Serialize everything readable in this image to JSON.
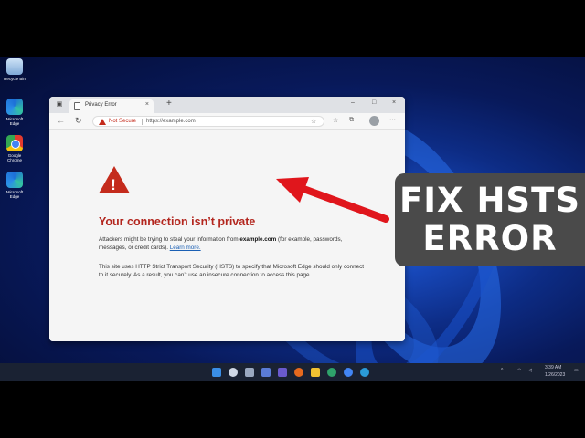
{
  "desktop": {
    "icons": [
      {
        "label": "Recycle Bin",
        "type": "recycle"
      },
      {
        "label": "Microsoft Edge",
        "type": "edge"
      },
      {
        "label": "Google Chrome",
        "type": "chrome"
      },
      {
        "label": "Microsoft Edge",
        "type": "edge"
      }
    ]
  },
  "browser": {
    "tab_title": "Privacy Error",
    "tab_close": "×",
    "new_tab": "+",
    "window_controls": {
      "minimize": "–",
      "maximize": "□",
      "close": "×"
    },
    "nav": {
      "back": "←",
      "refresh": "↻"
    },
    "address": {
      "security": "Not Secure",
      "url": "https://example.com"
    },
    "toolbar_icons": [
      "favorites-icon",
      "collections-icon",
      "browser-essentials-icon",
      "profile-icon",
      "more-icon"
    ],
    "more": "···"
  },
  "error_page": {
    "title": "Your connection isn’t private",
    "p1_prefix": "Attackers might be trying to steal your information from ",
    "p1_domain": "example.com",
    "p1_suffix": " (for example, passwords, messages, or credit cards). ",
    "learn_more": "Learn more.",
    "p2": "This site uses HTTP Strict Transport Security (HSTS) to specify that Microsoft Edge should only connect to it securely. As a result, you can’t use an insecure connection to access this page."
  },
  "overlay": {
    "line1": "FIX HSTS",
    "line2": "ERROR",
    "arrow_color": "#e0161c",
    "badge_color": "#4a4a4a"
  },
  "taskbar": {
    "clock_time": "3:39 AM",
    "clock_date": "1/26/2023"
  }
}
